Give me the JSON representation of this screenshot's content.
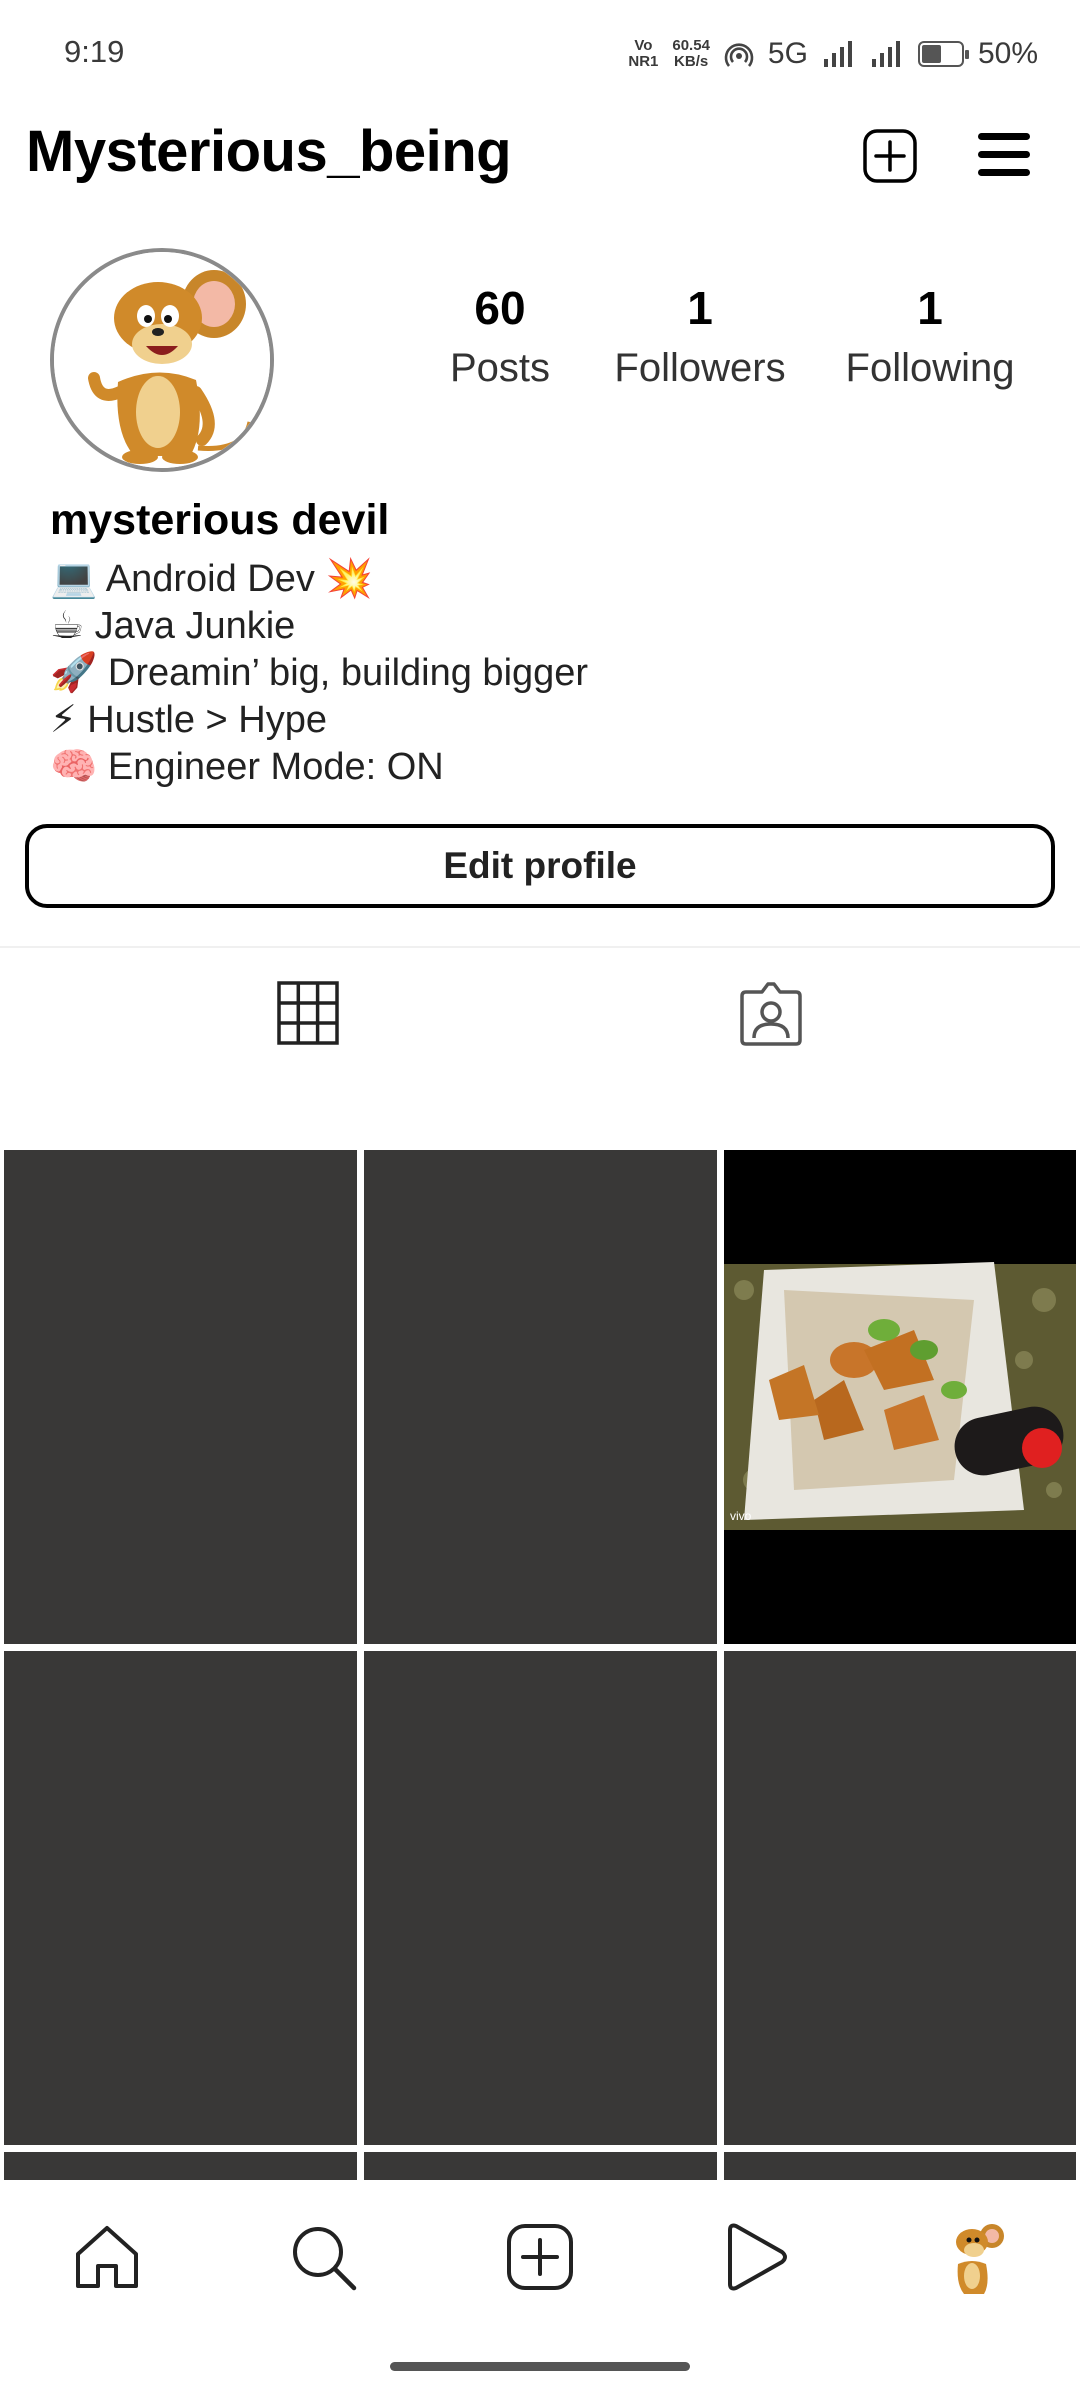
{
  "status_bar": {
    "time": "9:19",
    "net_top": "Vo",
    "net_bottom": "NR1",
    "speed_value": "60.54",
    "speed_unit": "KB/s",
    "network": "5G",
    "battery": "50%"
  },
  "header": {
    "username": "Mysterious_being",
    "create_icon": "plus-square-icon",
    "menu_icon": "hamburger-menu-icon"
  },
  "stats": [
    {
      "value": "60",
      "label": "Posts"
    },
    {
      "value": "1",
      "label": "Followers"
    },
    {
      "value": "1",
      "label": "Following"
    }
  ],
  "profile": {
    "display_name": "mysterious devil",
    "bio_lines": [
      "💻 Android Dev 💥",
      "☕ Java Junkie",
      "🚀 Dreamin’ big, building bigger",
      "⚡ Hustle > Hype",
      "🧠 Engineer Mode: ON"
    ],
    "edit_button": "Edit profile"
  },
  "tabs": [
    {
      "icon": "grid-icon",
      "active": true
    },
    {
      "icon": "tagged-person-icon",
      "active": false
    }
  ],
  "grid": {
    "tile_color": "#393837",
    "photo_caption": "vivo"
  },
  "bottom_nav": [
    "home-icon",
    "search-icon",
    "create-icon",
    "reels-icon",
    "profile-avatar-icon"
  ],
  "colors": {
    "text": "#000000",
    "tile": "#393837",
    "accent_red": "#e02020"
  }
}
